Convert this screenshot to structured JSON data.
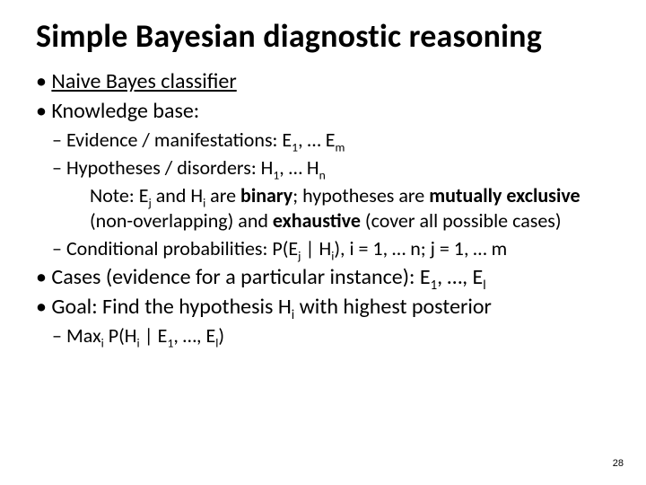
{
  "title": "Simple Bayesian diagnostic reasoning",
  "b1": {
    "label": "Naive Bayes classifier"
  },
  "b2": {
    "label": "Knowledge base:"
  },
  "b2s1": {
    "pre": "Evidence / manifestations: E",
    "sub1": "1",
    "mid": ", … E",
    "sub2": "m"
  },
  "b2s2": {
    "pre": "Hypotheses / disorders: H",
    "sub1": "1",
    "mid": ", … H",
    "sub2": "n"
  },
  "note": {
    "p1": "Note: E",
    "s1": "j",
    "p2": " and H",
    "s2": "i",
    "p3": " are ",
    "bold1": "binary",
    "p4": "; hypotheses are ",
    "bold2": "mutually exclusive",
    "p5": " (non-overlapping) and ",
    "bold3": "exhaustive",
    "p6": " (cover all possible cases)"
  },
  "b2s3": {
    "p1": "Conditional probabilities: P(E",
    "s1": "j",
    "p2": " | H",
    "s2": "i",
    "p3": "), i = 1, … n; j = 1, … m"
  },
  "b3": {
    "p1": "Cases (evidence for a particular instance): E",
    "s1": "1",
    "p2": ", …, E",
    "s2": "l"
  },
  "b4": {
    "p1": "Goal: Find the hypothesis H",
    "s1": "i",
    "p2": " with highest posterior"
  },
  "b4s1": {
    "p1": "Max",
    "s1": "i",
    "p2": " P(H",
    "s2": "i",
    "p3": " | E",
    "s3": "1",
    "p4": ", …, E",
    "s4": "l",
    "p5": ")"
  },
  "page": "28"
}
